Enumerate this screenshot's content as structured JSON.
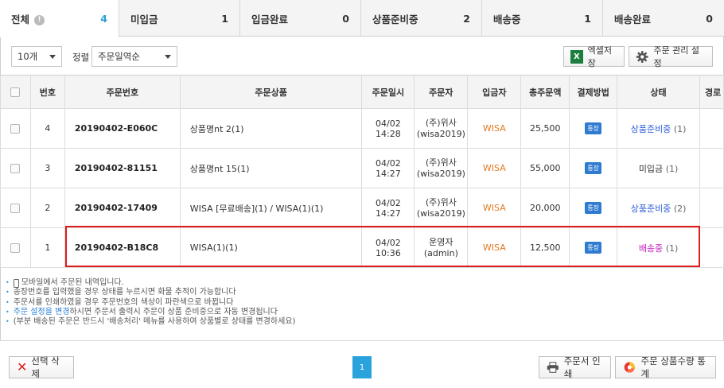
{
  "tabs": [
    {
      "label": "전체",
      "count": "4",
      "active": true
    },
    {
      "label": "미입금",
      "count": "1"
    },
    {
      "label": "입금완료",
      "count": "0"
    },
    {
      "label": "상품준비중",
      "count": "2"
    },
    {
      "label": "배송중",
      "count": "1"
    },
    {
      "label": "배송완료",
      "count": "0"
    }
  ],
  "toolbar": {
    "page_size": "10개",
    "sort_label": "정렬",
    "sort_value": "주문일역순",
    "excel_label": "엑셀저장",
    "manage_label": "주문 관리 설정"
  },
  "table": {
    "headers": [
      "번호",
      "주문번호",
      "주문상품",
      "주문일시",
      "주문자",
      "입금자",
      "총주문액",
      "결제방법",
      "상태",
      "경로"
    ],
    "rows": [
      {
        "no": "4",
        "order_no": "20190402-E060C",
        "product": "상품명nt 2(1)",
        "date": "04/02 14:28",
        "buyer": "(주)위사(wisa2019)",
        "depositor": "WISA",
        "amount": "25,500",
        "pay": "통장",
        "status": "상품준비중",
        "status_count": "(1)",
        "status_color": "#2a5bd7"
      },
      {
        "no": "3",
        "order_no": "20190402-81151",
        "product": "상품명nt 15(1)",
        "date": "04/02 14:27",
        "buyer": "(주)위사(wisa2019)",
        "depositor": "WISA",
        "amount": "55,000",
        "pay": "통장",
        "status": "미입금",
        "status_count": "(1)",
        "status_color": "#333333"
      },
      {
        "no": "2",
        "order_no": "20190402-17409",
        "product": "WISA [무료배송](1) / WISA(1)(1)",
        "date": "04/02 14:27",
        "buyer": "(주)위사(wisa2019)",
        "depositor": "WISA",
        "amount": "20,000",
        "pay": "통장",
        "status": "상품준비중",
        "status_count": "(2)",
        "status_color": "#2a5bd7"
      },
      {
        "no": "1",
        "order_no": "20190402-B18C8",
        "product": "WISA(1)(1)",
        "date": "04/02 10:36",
        "buyer": "운영자(admin)",
        "depositor": "WISA",
        "amount": "12,500",
        "pay": "통장",
        "status": "배송중",
        "status_count": "(1)",
        "status_color": "#c020c0"
      }
    ]
  },
  "notes": {
    "n1": "모바일에서 주문된 내역입니다.",
    "n2": "송장번호를 입력했을 경우 상태를 누르시면 화물 추적이 가능합니다",
    "n3": "주문서를 인쇄하였을 경우 주문번호의 색상이 파란색으로 바뀝니다",
    "n4_link": "주문 설정을 변경",
    "n4_rest": "하시면 주문서 출력시 주문이 상품 준비중으로 자동 변경됩니다",
    "n5": "(부분 배송된 주문은 반드시 '배송처리' 메뉴를 사용하여 상품별로 상태를 변경하세요)"
  },
  "footer": {
    "delete_label": "선택 삭제",
    "page": "1",
    "print_label": "주문서 인쇄",
    "stats_label": "주문 상품수량 통계"
  },
  "colors": {
    "accent": "#2a9fd6",
    "highlight": "#e01b1b",
    "depositor": "#e07a1f"
  }
}
